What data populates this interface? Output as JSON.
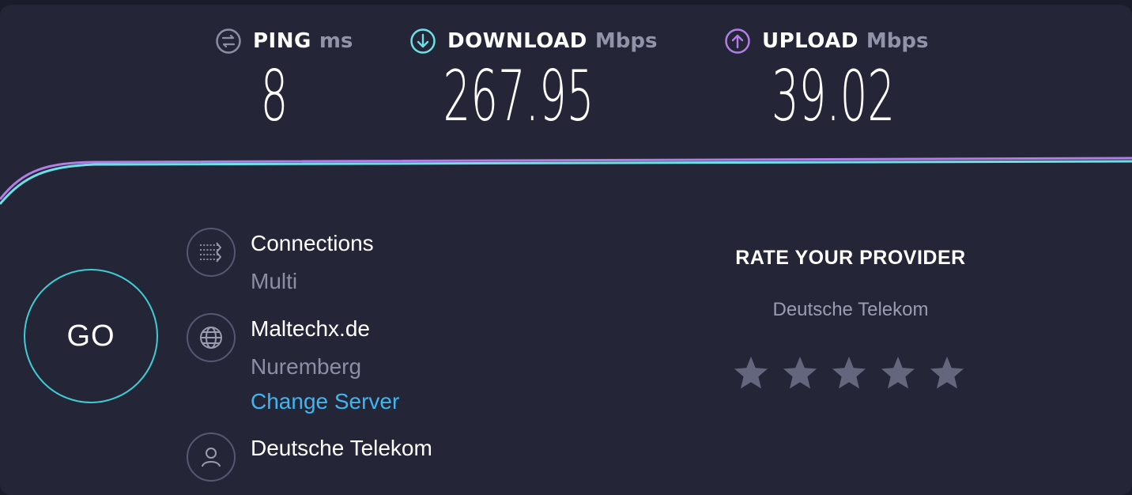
{
  "metrics": {
    "ping": {
      "label": "PING",
      "unit": "ms",
      "value": "8",
      "icon": "ping-icon"
    },
    "download": {
      "label": "DOWNLOAD",
      "unit": "Mbps",
      "value": "267.95",
      "icon": "download-arrow-icon"
    },
    "upload": {
      "label": "UPLOAD",
      "unit": "Mbps",
      "value": "39.02",
      "icon": "upload-arrow-icon"
    }
  },
  "colors": {
    "background": "#242638",
    "download_accent": "#6ce0e6",
    "upload_accent": "#b27ee6",
    "link": "#3fb6f0",
    "go_ring": "#3ecdd3"
  },
  "go_button": {
    "label": "GO"
  },
  "info": {
    "connections": {
      "title": "Connections",
      "value": "Multi",
      "icon": "connections-icon"
    },
    "server": {
      "title": "Maltechx.de",
      "location": "Nuremberg",
      "change_label": "Change Server",
      "icon": "globe-icon"
    },
    "provider": {
      "title": "Deutsche Telekom",
      "icon": "user-icon"
    }
  },
  "rating": {
    "title": "RATE YOUR PROVIDER",
    "provider": "Deutsche Telekom",
    "max_stars": 5,
    "selected": 0
  }
}
